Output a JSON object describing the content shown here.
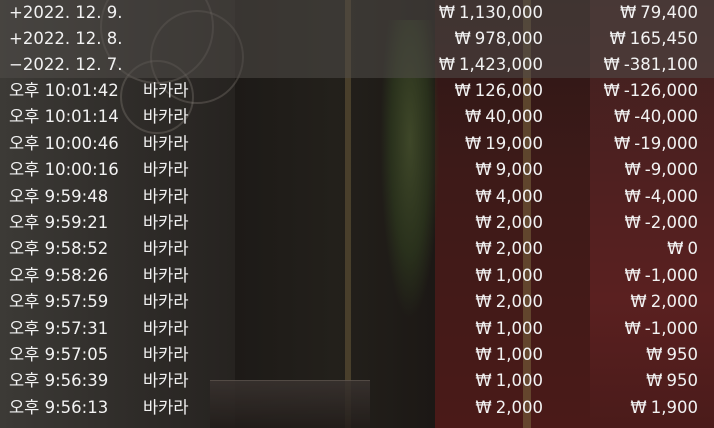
{
  "currency_symbol": "₩",
  "summary_rows": [
    {
      "date": "+2022. 12. 9.",
      "bet": "1,130,000",
      "result": "79,400"
    },
    {
      "date": "+2022. 12. 8.",
      "bet": "978,000",
      "result": "165,450"
    },
    {
      "date": "−2022. 12. 7.",
      "bet": "1,423,000",
      "result": "-381,100"
    }
  ],
  "detail_rows": [
    {
      "time": "오후 10:01:42",
      "game": "바카라",
      "bet": "126,000",
      "result": "-126,000"
    },
    {
      "time": "오후 10:01:14",
      "game": "바카라",
      "bet": "40,000",
      "result": "-40,000"
    },
    {
      "time": "오후 10:00:46",
      "game": "바카라",
      "bet": "19,000",
      "result": "-19,000"
    },
    {
      "time": "오후 10:00:16",
      "game": "바카라",
      "bet": "9,000",
      "result": "-9,000"
    },
    {
      "time": "오후 9:59:48",
      "game": "바카라",
      "bet": "4,000",
      "result": "-4,000"
    },
    {
      "time": "오후 9:59:21",
      "game": "바카라",
      "bet": "2,000",
      "result": "-2,000"
    },
    {
      "time": "오후 9:58:52",
      "game": "바카라",
      "bet": "2,000",
      "result": "0"
    },
    {
      "time": "오후 9:58:26",
      "game": "바카라",
      "bet": "1,000",
      "result": "-1,000"
    },
    {
      "time": "오후 9:57:59",
      "game": "바카라",
      "bet": "2,000",
      "result": "2,000"
    },
    {
      "time": "오후 9:57:31",
      "game": "바카라",
      "bet": "1,000",
      "result": "-1,000"
    },
    {
      "time": "오후 9:57:05",
      "game": "바카라",
      "bet": "1,000",
      "result": "950"
    },
    {
      "time": "오후 9:56:39",
      "game": "바카라",
      "bet": "1,000",
      "result": "950"
    },
    {
      "time": "오후 9:56:13",
      "game": "바카라",
      "bet": "2,000",
      "result": "1,900"
    }
  ]
}
